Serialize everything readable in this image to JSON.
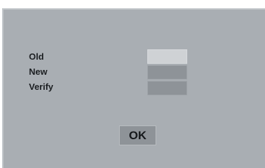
{
  "dialog": {
    "fields": [
      {
        "label": "Old",
        "value": ""
      },
      {
        "label": "New",
        "value": ""
      },
      {
        "label": "Verify",
        "value": ""
      }
    ],
    "ok_label": "OK"
  }
}
